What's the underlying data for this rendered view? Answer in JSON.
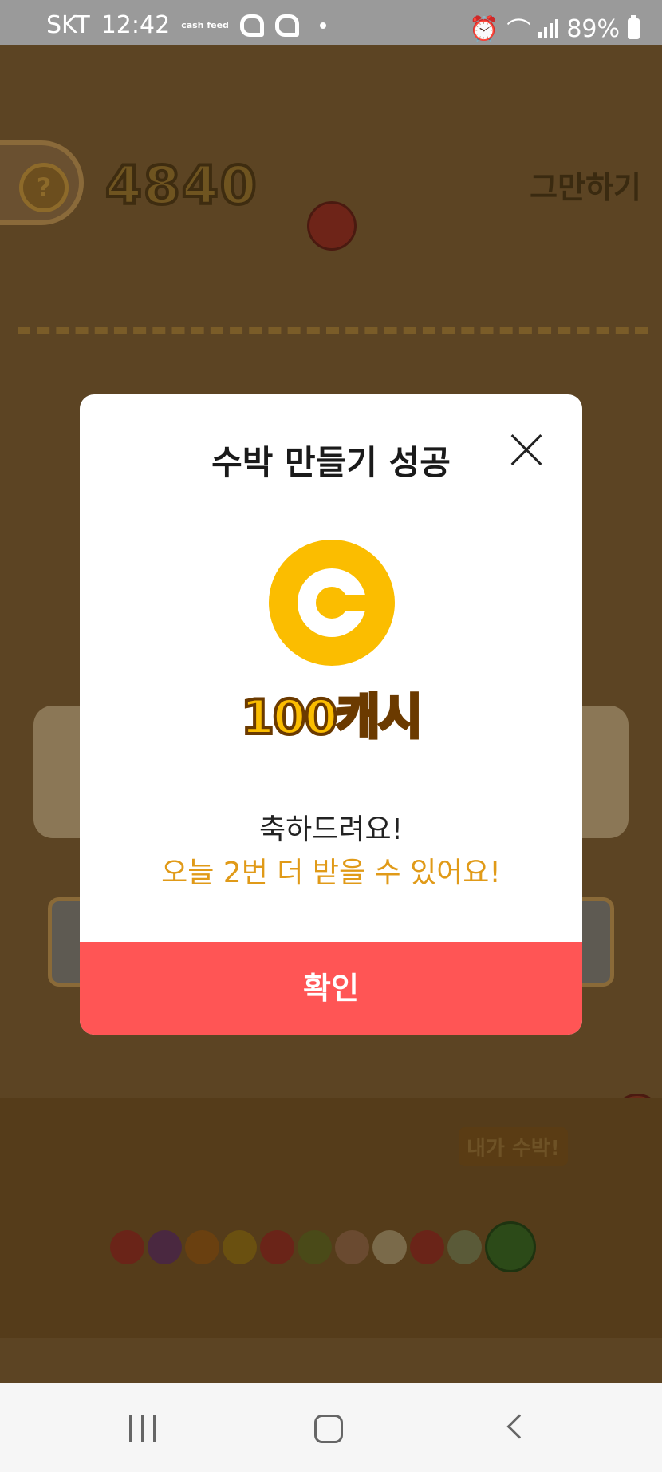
{
  "status_bar": {
    "carrier": "SKT",
    "time": "12:42",
    "app_badge": "cash feed",
    "battery": "89%"
  },
  "game": {
    "help_label": "?",
    "score": "4840",
    "quit_label": "그만하기",
    "evolution_tag": "내가 수박!",
    "evolution_fruits": [
      {
        "name": "cherry",
        "color": "#6a2418"
      },
      {
        "name": "grape",
        "color": "#4a2840"
      },
      {
        "name": "mandarin",
        "color": "#6a4010"
      },
      {
        "name": "lemon",
        "color": "#6a5010"
      },
      {
        "name": "apple",
        "color": "#6a2418"
      },
      {
        "name": "kiwi",
        "color": "#4a4a18"
      },
      {
        "name": "peach",
        "color": "#6a4a30"
      },
      {
        "name": "pear",
        "color": "#7a6a4a"
      },
      {
        "name": "tomato",
        "color": "#6a2418"
      },
      {
        "name": "melon",
        "color": "#5a5a38"
      },
      {
        "name": "watermelon",
        "color": "#2c4a18"
      }
    ]
  },
  "modal": {
    "title": "수박 만들기 성공",
    "reward_label": "100캐시",
    "message_primary": "축하드려요!",
    "message_secondary": "오늘 2번 더 받을 수 있어요!",
    "confirm_label": "확인",
    "colors": {
      "coin": "#fbbd00",
      "confirm": "#ff5555",
      "highlight": "#e09a18"
    }
  }
}
